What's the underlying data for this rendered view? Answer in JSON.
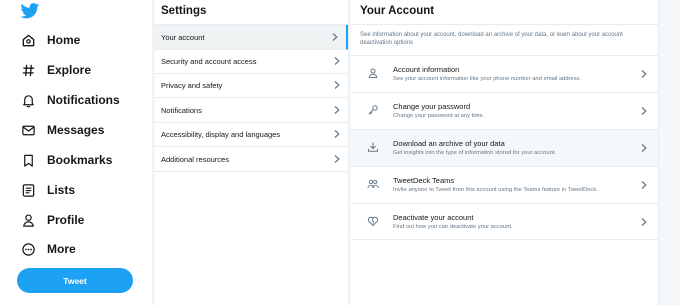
{
  "nav": {
    "items": [
      {
        "label": "Home",
        "icon": "home-icon"
      },
      {
        "label": "Explore",
        "icon": "hashtag-icon"
      },
      {
        "label": "Notifications",
        "icon": "bell-icon"
      },
      {
        "label": "Messages",
        "icon": "envelope-icon"
      },
      {
        "label": "Bookmarks",
        "icon": "bookmark-icon"
      },
      {
        "label": "Lists",
        "icon": "list-icon"
      },
      {
        "label": "Profile",
        "icon": "person-icon"
      },
      {
        "label": "More",
        "icon": "more-icon"
      }
    ],
    "tweet_label": "Tweet",
    "logo": "twitter-bird-icon"
  },
  "settings": {
    "title": "Settings",
    "items": [
      {
        "label": "Your account"
      },
      {
        "label": "Security and account access"
      },
      {
        "label": "Privacy and safety"
      },
      {
        "label": "Notifications"
      },
      {
        "label": "Accessibility, display and languages"
      },
      {
        "label": "Additional resources"
      }
    ]
  },
  "account": {
    "title": "Your Account",
    "description": "See information about your account, download an archive of your data, or learn about your account deactivation options",
    "items": [
      {
        "title": "Account information",
        "subtitle": "See your account information like your phone number and email address.",
        "icon": "person-icon"
      },
      {
        "title": "Change your password",
        "subtitle": "Change your password at any time.",
        "icon": "key-icon"
      },
      {
        "title": "Download an archive of your data",
        "subtitle": "Get insights into the type of information stored for your account.",
        "icon": "download-icon"
      },
      {
        "title": "TweetDeck Teams",
        "subtitle": "Invite anyone to Tweet from this account using the Teams feature in TweetDeck.",
        "icon": "team-icon"
      },
      {
        "title": "Deactivate your account",
        "subtitle": "Find out how you can deactivate your account.",
        "icon": "broken-heart-icon"
      }
    ]
  },
  "colors": {
    "accent": "#1da1f2",
    "text": "#14171a",
    "muted": "#657786",
    "border": "#e6ecf0"
  }
}
